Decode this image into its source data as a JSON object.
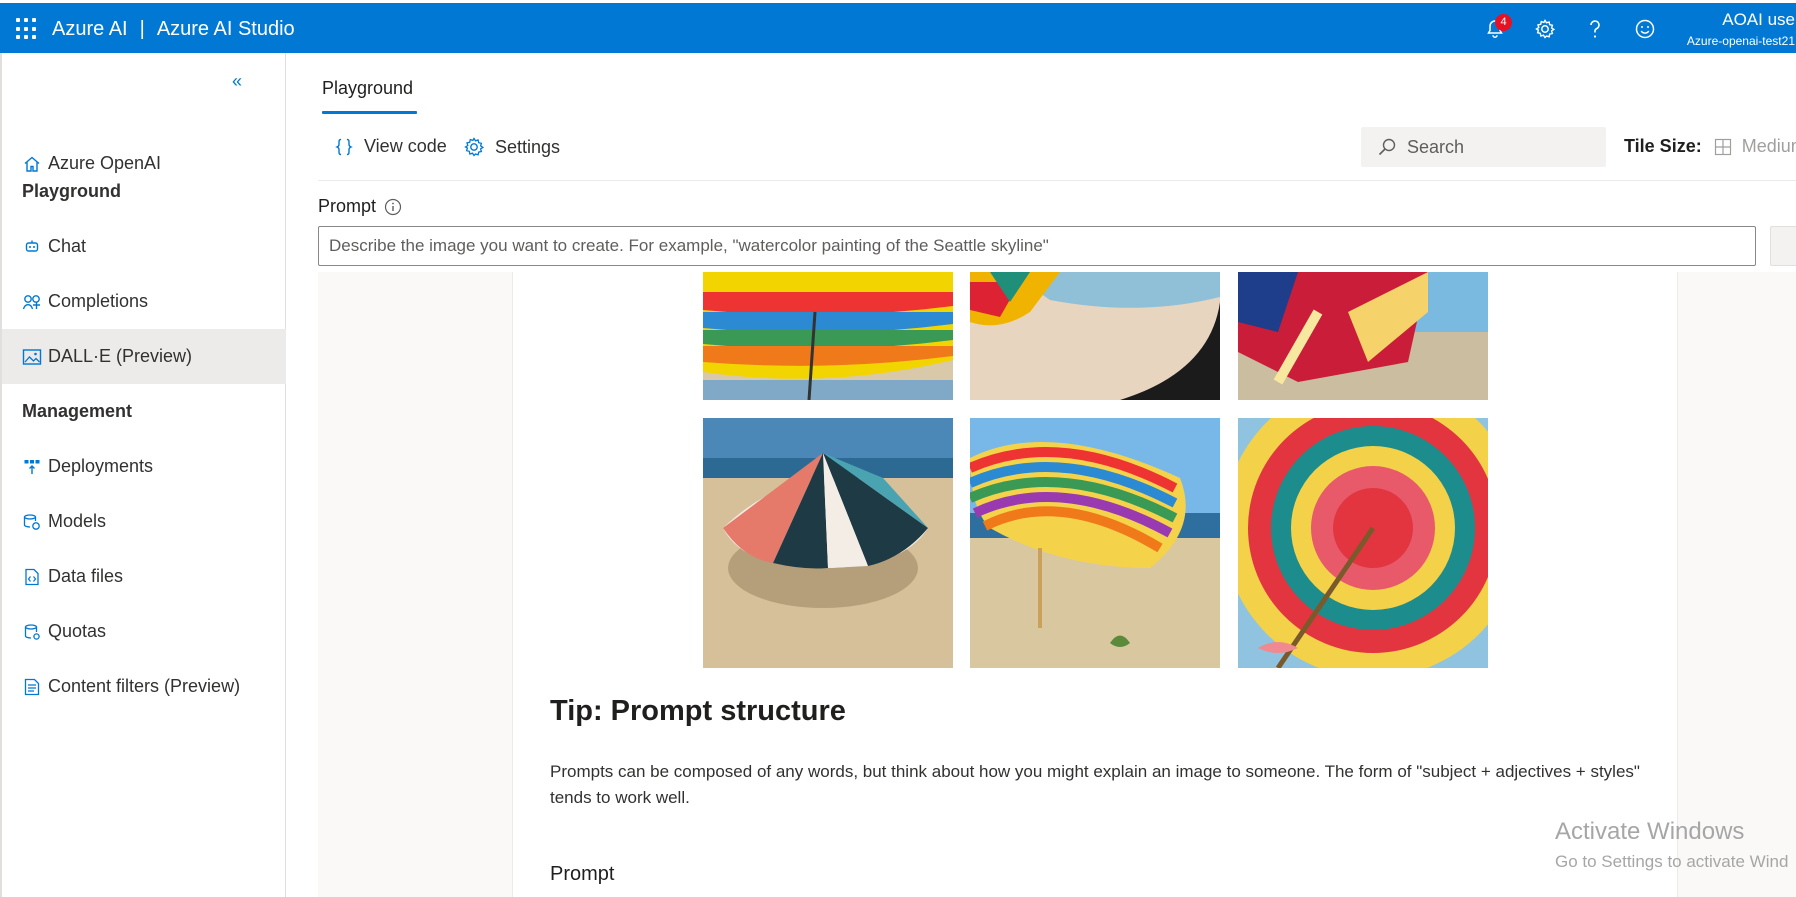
{
  "topbar": {
    "brand_left": "Azure AI",
    "brand_sep": "|",
    "brand_right": "Azure AI Studio",
    "notification_count": "4",
    "user_name": "AOAI use",
    "user_org": "Azure-openai-test21",
    "icons": [
      "waffle-icon",
      "bell-icon",
      "gear-icon",
      "help-icon",
      "feedback-smiley-icon"
    ]
  },
  "sidebar": {
    "collapse_icon": "double-chevron-left-icon",
    "items": [
      {
        "label": "Azure OpenAI",
        "icon": "home-icon"
      },
      {
        "label": "Chat",
        "icon": "chat-bot-icon"
      },
      {
        "label": "Completions",
        "icon": "completions-icon"
      },
      {
        "label": "DALL·E (Preview)",
        "icon": "image-icon"
      },
      {
        "label": "Deployments",
        "icon": "deployments-icon"
      },
      {
        "label": "Models",
        "icon": "models-icon"
      },
      {
        "label": "Data files",
        "icon": "data-file-icon"
      },
      {
        "label": "Quotas",
        "icon": "quotas-icon"
      },
      {
        "label": "Content filters (Preview)",
        "icon": "content-filter-icon"
      }
    ],
    "sections": [
      "Playground",
      "Management"
    ]
  },
  "main": {
    "tab": "Playground",
    "view_code": "View code",
    "settings": "Settings",
    "search_placeholder": "Search",
    "tile_size_label": "Tile Size:",
    "tile_size_value": "Medium",
    "prompt_label": "Prompt",
    "prompt_placeholder": "Describe the image you want to create. For example, \"watercolor painting of the Seattle skyline\"",
    "tip_title": "Tip: Prompt structure",
    "tip_text": "Prompts can be composed of any words, but think about how you might explain an image to someone. The form of \"subject + adjectives + styles\" tends to work well.",
    "tip_prompt_heading": "Prompt"
  },
  "watermark": {
    "line1": "Activate Windows",
    "line2": "Go to Settings to activate Wind"
  },
  "colors": {
    "brand_blue": "#0078d4",
    "badge_red": "#e81123",
    "active_nav_bg": "#edebe9"
  }
}
